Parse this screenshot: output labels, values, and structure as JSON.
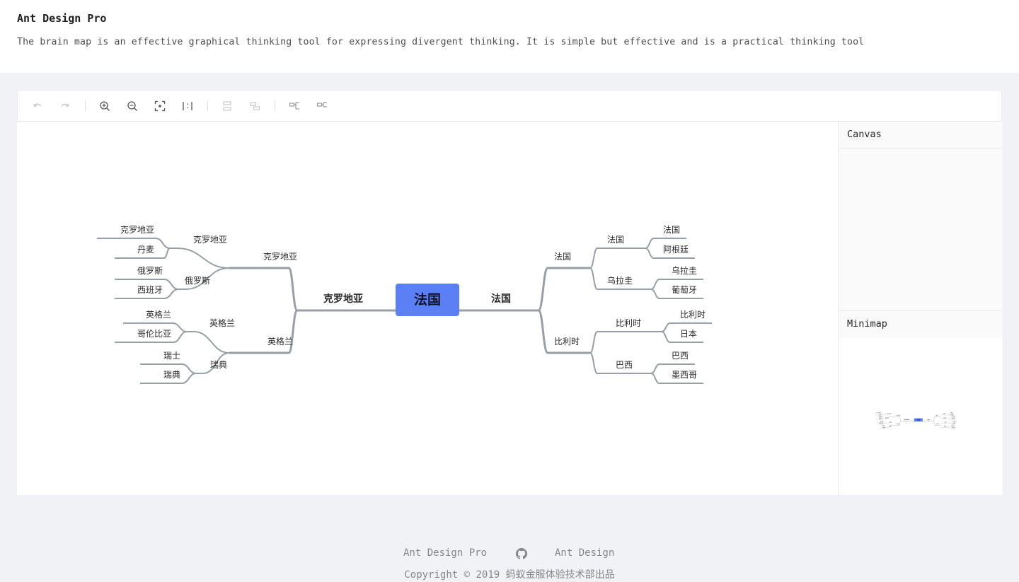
{
  "header": {
    "title": "Ant Design Pro",
    "description": "The brain map is an effective graphical thinking tool for expressing divergent thinking. It is simple but effective and is a practical thinking tool"
  },
  "toolbar": {
    "buttons": [
      {
        "name": "undo",
        "icon": "undo-icon"
      },
      {
        "name": "redo",
        "icon": "redo-icon"
      },
      {
        "name": "zoom-in",
        "icon": "zoom-in-icon"
      },
      {
        "name": "zoom-out",
        "icon": "zoom-out-icon"
      },
      {
        "name": "auto-zoom",
        "icon": "fit-view-icon"
      },
      {
        "name": "reset-zoom",
        "icon": "actual-size-icon"
      },
      {
        "name": "append",
        "icon": "add-sibling-icon"
      },
      {
        "name": "append-child",
        "icon": "add-child-icon"
      },
      {
        "name": "collapse",
        "icon": "collapse-icon"
      },
      {
        "name": "expand",
        "icon": "expand-icon"
      }
    ]
  },
  "mindmap": {
    "root": "法国",
    "left": {
      "label": "克罗地亚",
      "children": [
        {
          "label": "克罗地亚",
          "children": [
            {
              "label": "克罗地亚",
              "children": [
                "克罗地亚",
                "丹麦"
              ]
            },
            {
              "label": "俄罗斯",
              "children": [
                "俄罗斯",
                "西班牙"
              ]
            }
          ]
        },
        {
          "label": "英格兰",
          "children": [
            {
              "label": "英格兰",
              "children": [
                "英格兰",
                "哥伦比亚"
              ]
            },
            {
              "label": "瑞典",
              "children": [
                "瑞士",
                "瑞典"
              ]
            }
          ]
        }
      ]
    },
    "right": {
      "label": "法国",
      "children": [
        {
          "label": "法国",
          "children": [
            {
              "label": "法国",
              "children": [
                "法国",
                "阿根廷"
              ]
            },
            {
              "label": "乌拉圭",
              "children": [
                "乌拉圭",
                "葡萄牙"
              ]
            }
          ]
        },
        {
          "label": "比利时",
          "children": [
            {
              "label": "比利时",
              "children": [
                "比利时",
                "日本"
              ]
            },
            {
              "label": "巴西",
              "children": [
                "巴西",
                "墨西哥"
              ]
            }
          ]
        }
      ]
    }
  },
  "panels": {
    "canvas": "Canvas",
    "minimap": "Minimap"
  },
  "footer": {
    "link1": "Ant Design Pro",
    "github_icon": "github-icon",
    "link2": "Ant Design",
    "copyright": "Copyright © 2019 蚂蚁金服体验技术部出品"
  },
  "colors": {
    "root_node": "#5b7ff5",
    "edge": "#989ea8",
    "page_bg": "#f0f2f5"
  }
}
